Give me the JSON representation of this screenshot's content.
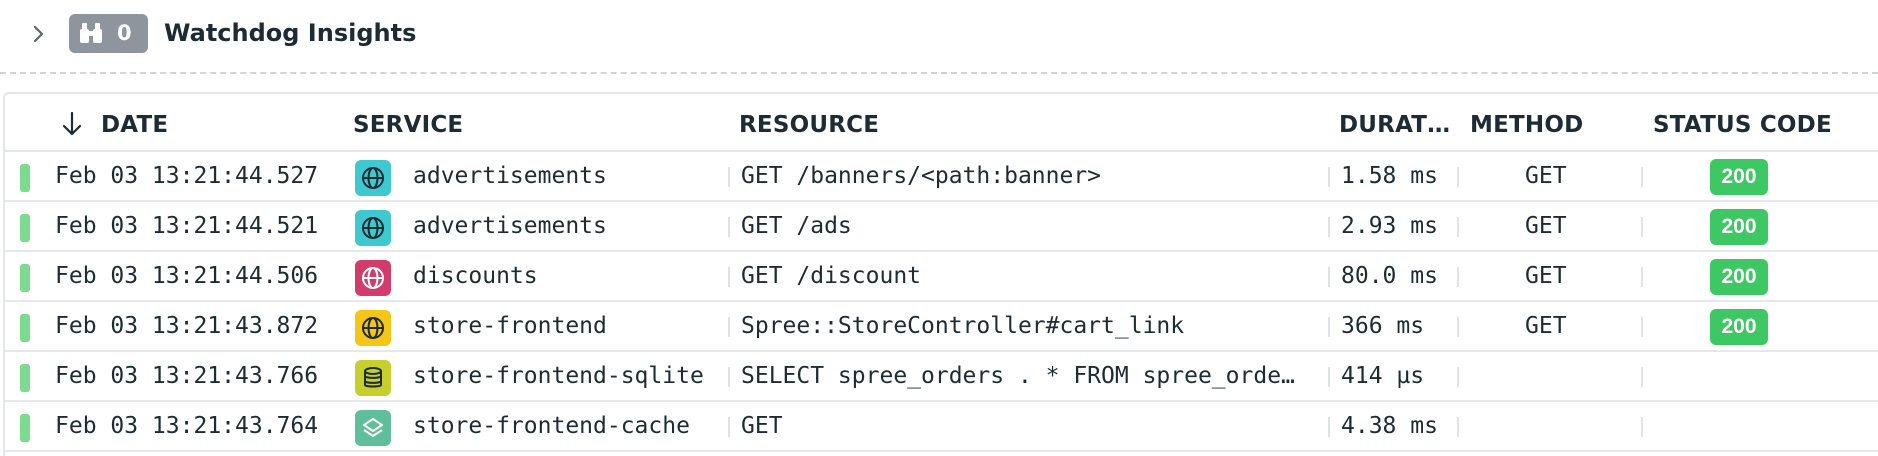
{
  "watchdog": {
    "title": "Watchdog Insights",
    "count": "0",
    "badge_color": "#8e959d"
  },
  "table": {
    "columns": {
      "date": "DATE",
      "service": "SERVICE",
      "resource": "RESOURCE",
      "duration": "DURAT…",
      "method": "METHOD",
      "status_code": "STATUS CODE"
    },
    "sort": {
      "column": "date",
      "direction": "descending",
      "icon": "arrow-down-icon"
    },
    "rows": [
      {
        "date": "Feb 03 13:21:44.527",
        "service": "advertisements",
        "service_icon": "globe-icon",
        "icon_color": "#3ec8d0",
        "resource": "GET /banners/<path:banner>",
        "duration": "1.58 ms",
        "method": "GET",
        "status_code": "200"
      },
      {
        "date": "Feb 03 13:21:44.521",
        "service": "advertisements",
        "service_icon": "globe-icon",
        "icon_color": "#3ec8d0",
        "resource": "GET /ads",
        "duration": "2.93 ms",
        "method": "GET",
        "status_code": "200"
      },
      {
        "date": "Feb 03 13:21:44.506",
        "service": "discounts",
        "service_icon": "globe-icon",
        "icon_color": "#d13c6a",
        "resource": "GET /discount",
        "duration": "80.0 ms",
        "method": "GET",
        "status_code": "200"
      },
      {
        "date": "Feb 03 13:21:43.872",
        "service": "store-frontend",
        "service_icon": "globe-icon",
        "icon_color": "#f5c518",
        "resource": "Spree::StoreController#cart_link",
        "duration": "366 ms",
        "method": "GET",
        "status_code": "200"
      },
      {
        "date": "Feb 03 13:21:43.766",
        "service": "store-frontend-sqlite",
        "service_icon": "database-icon",
        "icon_color": "#c6cf2c",
        "resource": "SELECT spree_orders . * FROM spree_orde…",
        "duration": "414 µs",
        "method": "",
        "status_code": ""
      },
      {
        "date": "Feb 03 13:21:43.764",
        "service": "store-frontend-cache",
        "service_icon": "layers-icon",
        "icon_color": "#5fbf9a",
        "resource": "GET",
        "duration": "4.38 ms",
        "method": "",
        "status_code": ""
      }
    ],
    "status_ok_color": "#3ec864",
    "row_status_color": "#7ddb8f"
  }
}
